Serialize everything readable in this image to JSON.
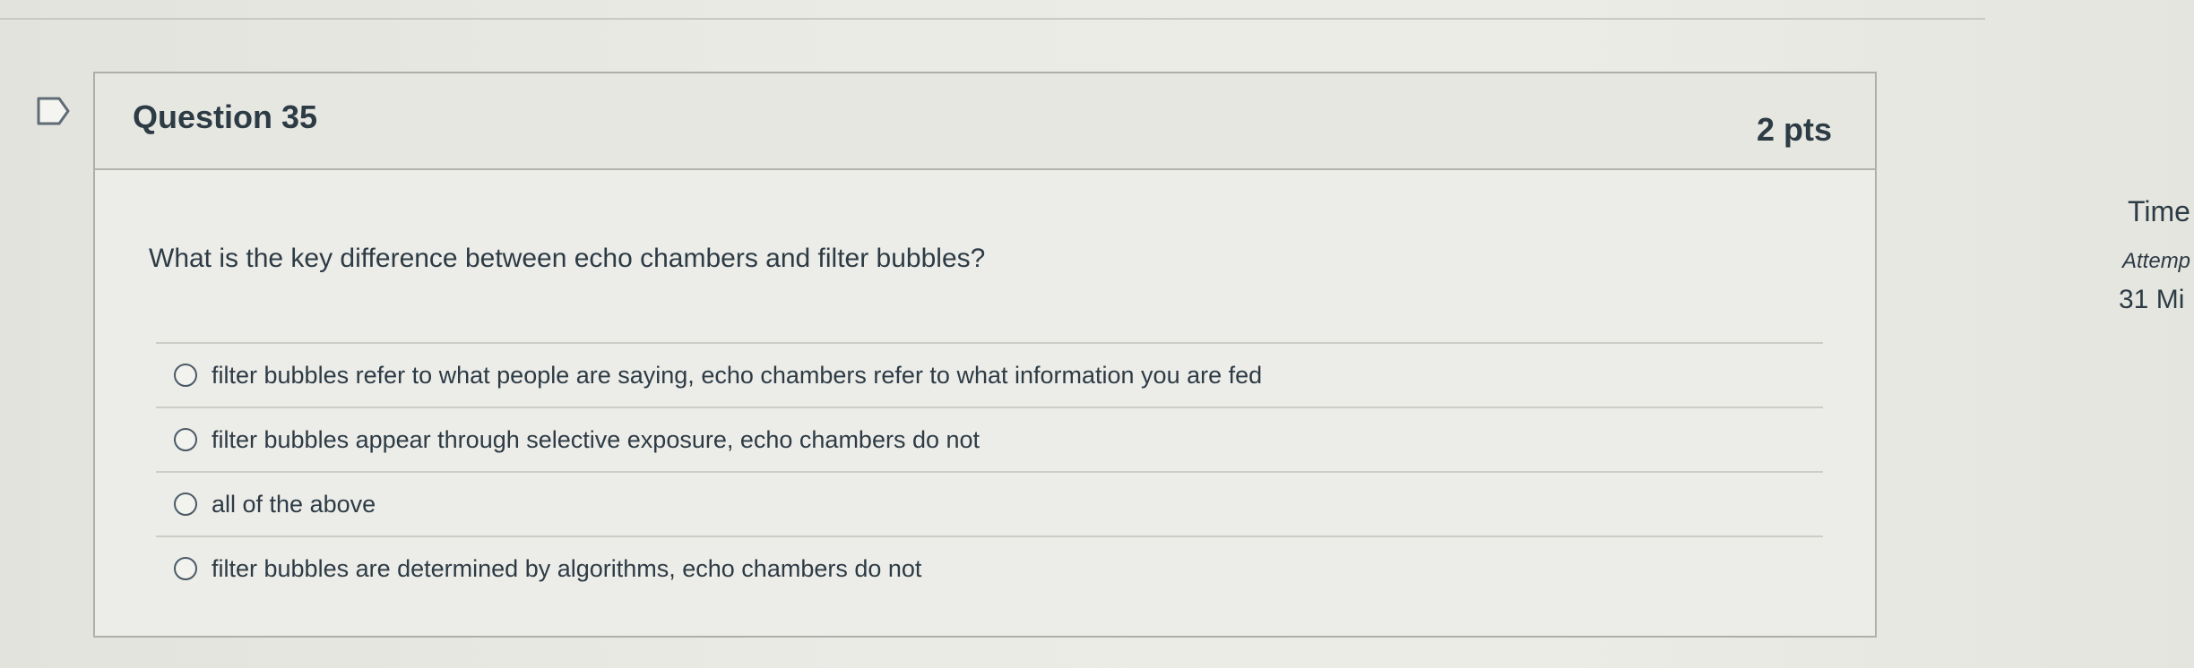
{
  "question": {
    "title": "Question 35",
    "points": "2 pts",
    "text": "What is the key difference between echo chambers and filter bubbles?",
    "answers": [
      {
        "label": "filter bubbles refer to what people are saying, echo chambers refer to what information you are fed"
      },
      {
        "label": "filter bubbles appear through selective exposure, echo chambers do not"
      },
      {
        "label": "all of the above"
      },
      {
        "label": "filter bubbles are determined by algorithms, echo chambers do not"
      }
    ]
  },
  "side_panel": {
    "time_label": "Time",
    "attempt_label": "Attemp",
    "minutes": "31 Mi"
  },
  "icons": {
    "flag": "flag-icon",
    "radio": "radio-unselected-icon"
  },
  "colors": {
    "text": "#2d3b45",
    "card_border": "#aeaeaa"
  }
}
